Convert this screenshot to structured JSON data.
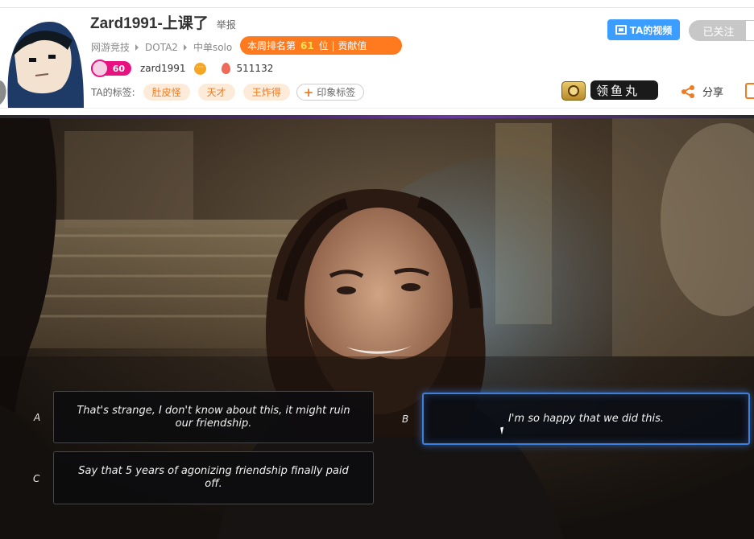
{
  "header": {
    "channel_title": "Zard1991-上课了",
    "report_label": "举报",
    "breadcrumb": [
      "网游竞技",
      "DOTA2",
      "中单solo"
    ],
    "rank": {
      "prefix": "本周排名第",
      "number": "61",
      "suffix": "位 | 贡献值"
    },
    "level": "60",
    "username": "zard1991",
    "heat": "511132",
    "tags_label": "TA的标签:",
    "tags": [
      "肚皮怪",
      "天才",
      "王炸得"
    ],
    "add_tag_label": "印象标签",
    "video_button": "TA的视频",
    "follow_button": "已关注",
    "fans_badge": "领鱼丸",
    "share_label": "分享"
  },
  "dialogue": {
    "options": [
      {
        "letter": "A",
        "text": "That's strange, I don't know about this, it might ruin our friendship."
      },
      {
        "letter": "B",
        "text": "I'm so happy that we did this."
      },
      {
        "letter": "C",
        "text": "Say that 5 years of agonizing friendship finally paid off."
      }
    ],
    "selected": "B"
  },
  "colors": {
    "rank_badge": "#ff7a1f",
    "video_button": "#3b9dff",
    "tag_text": "#f07b20",
    "selected_border": "#3f7fdc"
  }
}
